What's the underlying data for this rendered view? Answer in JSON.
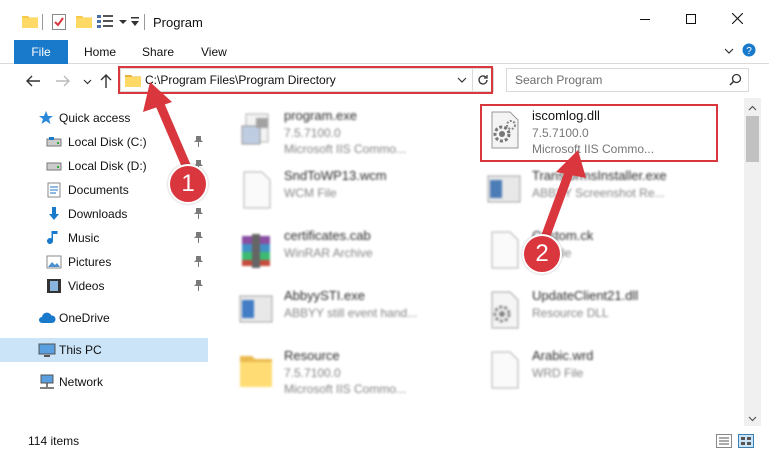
{
  "window": {
    "title": "Program",
    "minimize_icon": "minimize-icon",
    "maximize_icon": "maximize-icon",
    "close_icon": "close-icon"
  },
  "ribbon": {
    "tabs": [
      {
        "label": "File"
      },
      {
        "label": "Home"
      },
      {
        "label": "Share"
      },
      {
        "label": "View"
      }
    ]
  },
  "address": {
    "path": "C:\\Program Files\\Program Directory"
  },
  "search": {
    "placeholder": "Search Program"
  },
  "sidebar": {
    "quick_access": "Quick access",
    "items": [
      {
        "label": "Local Disk (C:)",
        "pinned": true
      },
      {
        "label": "Local Disk (D:)",
        "pinned": true
      },
      {
        "label": "Documents",
        "pinned": true
      },
      {
        "label": "Downloads",
        "pinned": true
      },
      {
        "label": "Music",
        "pinned": true
      },
      {
        "label": "Pictures",
        "pinned": true
      },
      {
        "label": "Videos",
        "pinned": true
      }
    ],
    "onedrive": "OneDrive",
    "this_pc": "This PC",
    "network": "Network"
  },
  "files": [
    {
      "name": "program.exe",
      "line1": "7.5.7100.0",
      "line2": "Microsoft IIS Commo...",
      "icon": "exe-icon"
    },
    {
      "name": "iscomlog.dll",
      "line1": "7.5.7100.0",
      "line2": "Microsoft IIS Commo...",
      "icon": "dll-gear-icon"
    },
    {
      "name": "SndToWP13.wcm",
      "line1": "WCM File",
      "line2": "",
      "icon": "generic-file-icon"
    },
    {
      "name": "TransformsInstaller.exe",
      "line1": "ABBYY Screenshot Re...",
      "line2": "",
      "icon": "exe-icon"
    },
    {
      "name": "certificates.cab",
      "line1": "WinRAR Archive",
      "line2": "",
      "icon": "winrar-icon"
    },
    {
      "name": "Custom.ck",
      "line1": "CK File",
      "line2": "",
      "icon": "generic-file-icon"
    },
    {
      "name": "AbbyySTI.exe",
      "line1": "ABBYY still event hand...",
      "line2": "",
      "icon": "exe-icon"
    },
    {
      "name": "UpdateClient21.dll",
      "line1": "Resource DLL",
      "line2": "",
      "icon": "dll-gear-icon"
    },
    {
      "name": "Resource",
      "line1": "7.5.7100.0",
      "line2": "Microsoft IIS Commo...",
      "icon": "folder-icon"
    },
    {
      "name": "Arabic.wrd",
      "line1": "WRD File",
      "line2": "",
      "icon": "generic-file-icon"
    }
  ],
  "status": {
    "item_count": "114 items"
  },
  "annotations": [
    {
      "number": "1"
    },
    {
      "number": "2"
    }
  ],
  "colors": {
    "accent": "#1979ca",
    "highlight": "#d9363e",
    "selected": "#cce4f7"
  }
}
